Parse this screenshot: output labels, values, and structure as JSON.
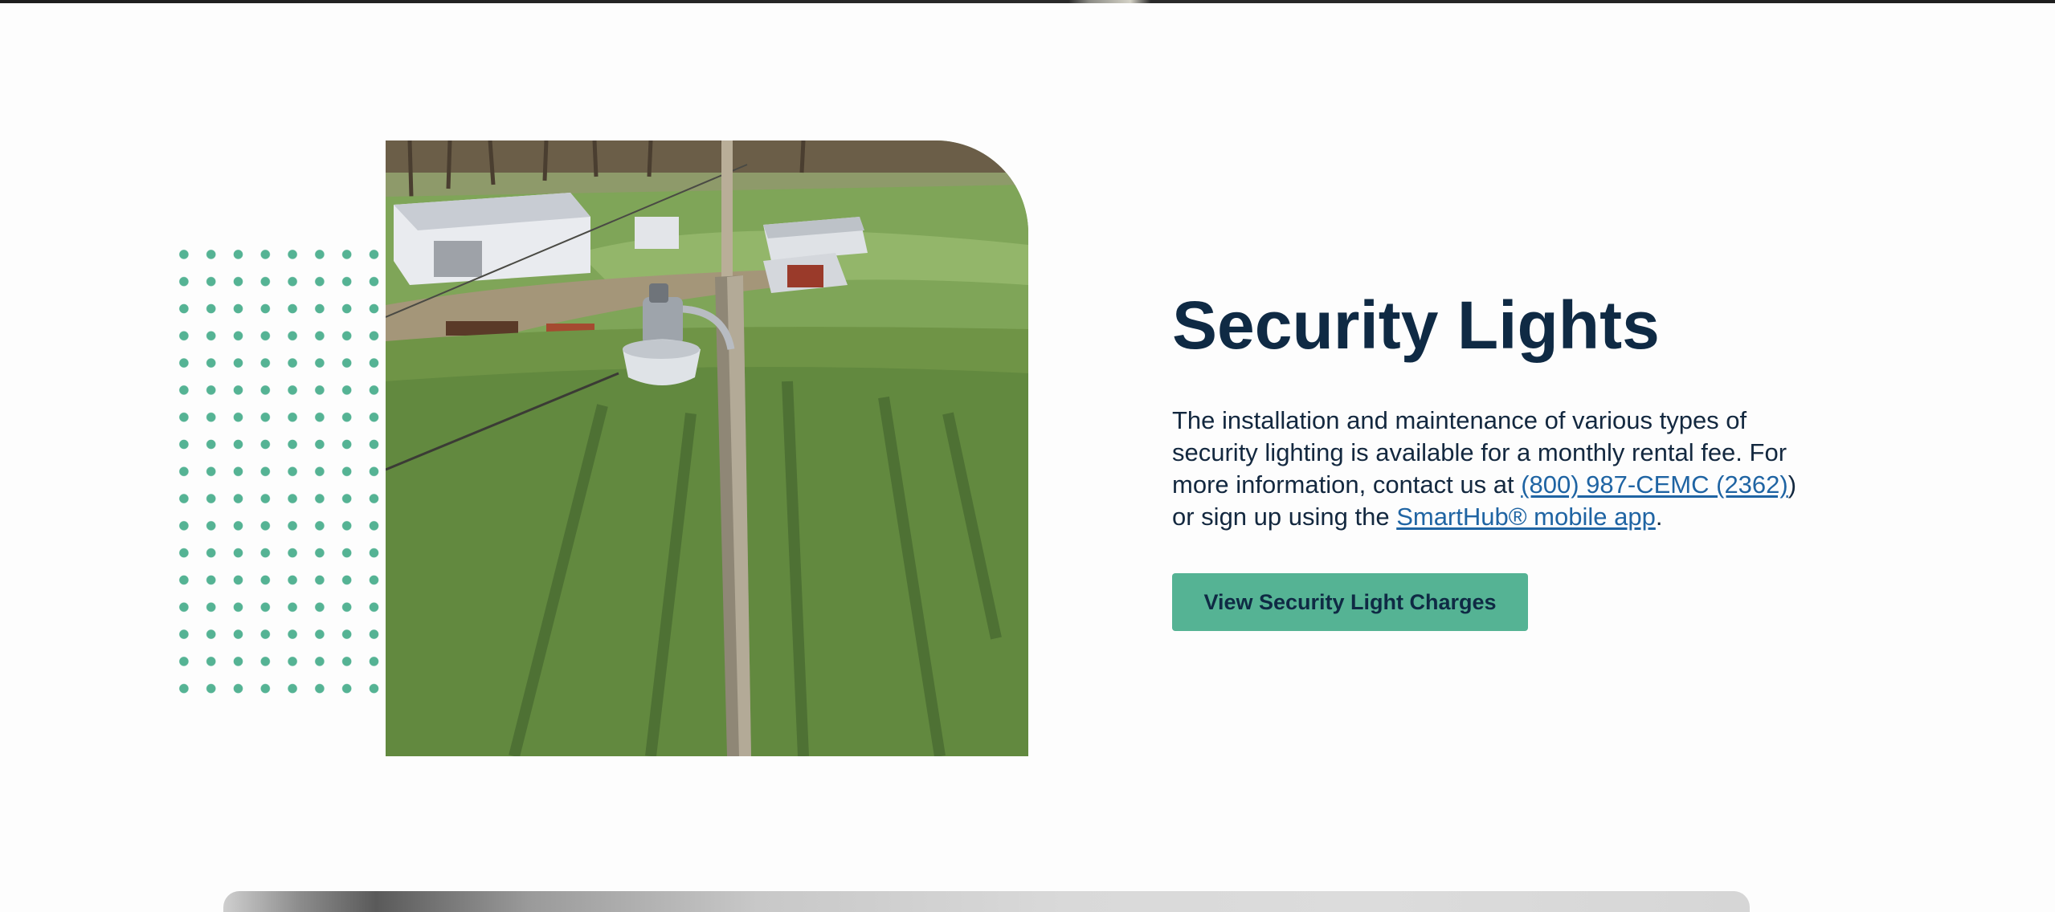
{
  "section": {
    "heading": "Security Lights",
    "body_part1": "The installation and maintenance of various types of security lighting is available for a monthly rental fee. For more information, contact us at ",
    "phone_link": "(800) 987-CEMC (2362)",
    "body_part2": ") or sign up using the ",
    "app_link": "SmartHub® mobile app",
    "body_part3": ".",
    "cta_label": "View Security Light Charges"
  },
  "colors": {
    "accent_green": "#55b394",
    "heading_navy": "#0f2a44",
    "link_blue": "#1f64a3"
  }
}
